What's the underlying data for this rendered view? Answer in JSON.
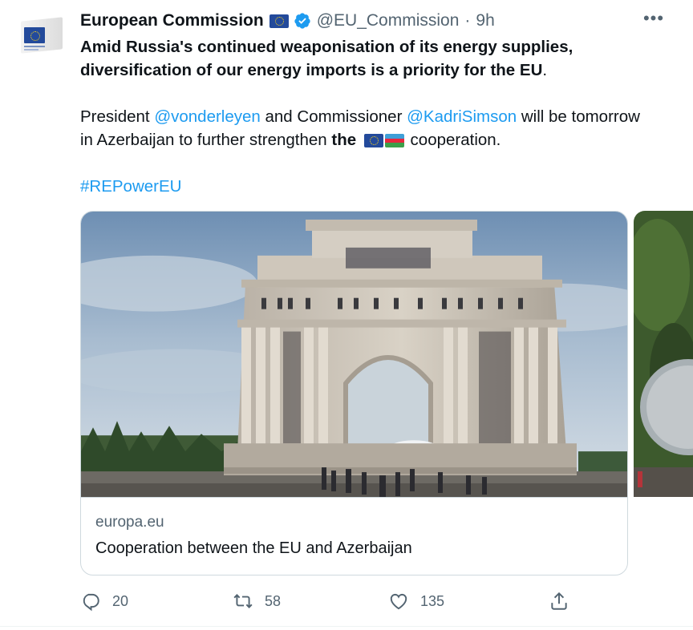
{
  "tweet": {
    "author_name": "European Commission",
    "handle": "@EU_Commission",
    "separator": "·",
    "time": "9h",
    "more_label": "•••",
    "line1": "Amid Russia's continued weaponisation of its energy supplies,",
    "line2_bold": "diversification of our energy imports is a priority for the EU",
    "line2_end": ".",
    "p2_president": "President ",
    "mention1": "@vonderleyen",
    "p2_and": " and Commissioner ",
    "mention2": "@KadriSimson",
    "p2_tomorrow": " will be tomorrow",
    "p3_start": "in Azerbaijan to further strengthen ",
    "p3_the": "the",
    "p3_end": " cooperation.",
    "hashtag": "#REPowerEU"
  },
  "card": {
    "domain": "europa.eu",
    "title": "Cooperation between the EU and Azerbaijan"
  },
  "actions": {
    "replies": "20",
    "retweets": "58",
    "likes": "135"
  },
  "colors": {
    "link": "#1d9bf0",
    "verified": "#1d9bf0",
    "secondary": "#536471",
    "eu_flag": "#234a9b"
  },
  "icons": [
    "eu-flag-icon",
    "verified-badge-icon",
    "more-icon",
    "reply-icon",
    "retweet-icon",
    "like-icon",
    "share-icon",
    "azerbaijan-flag-icon"
  ]
}
